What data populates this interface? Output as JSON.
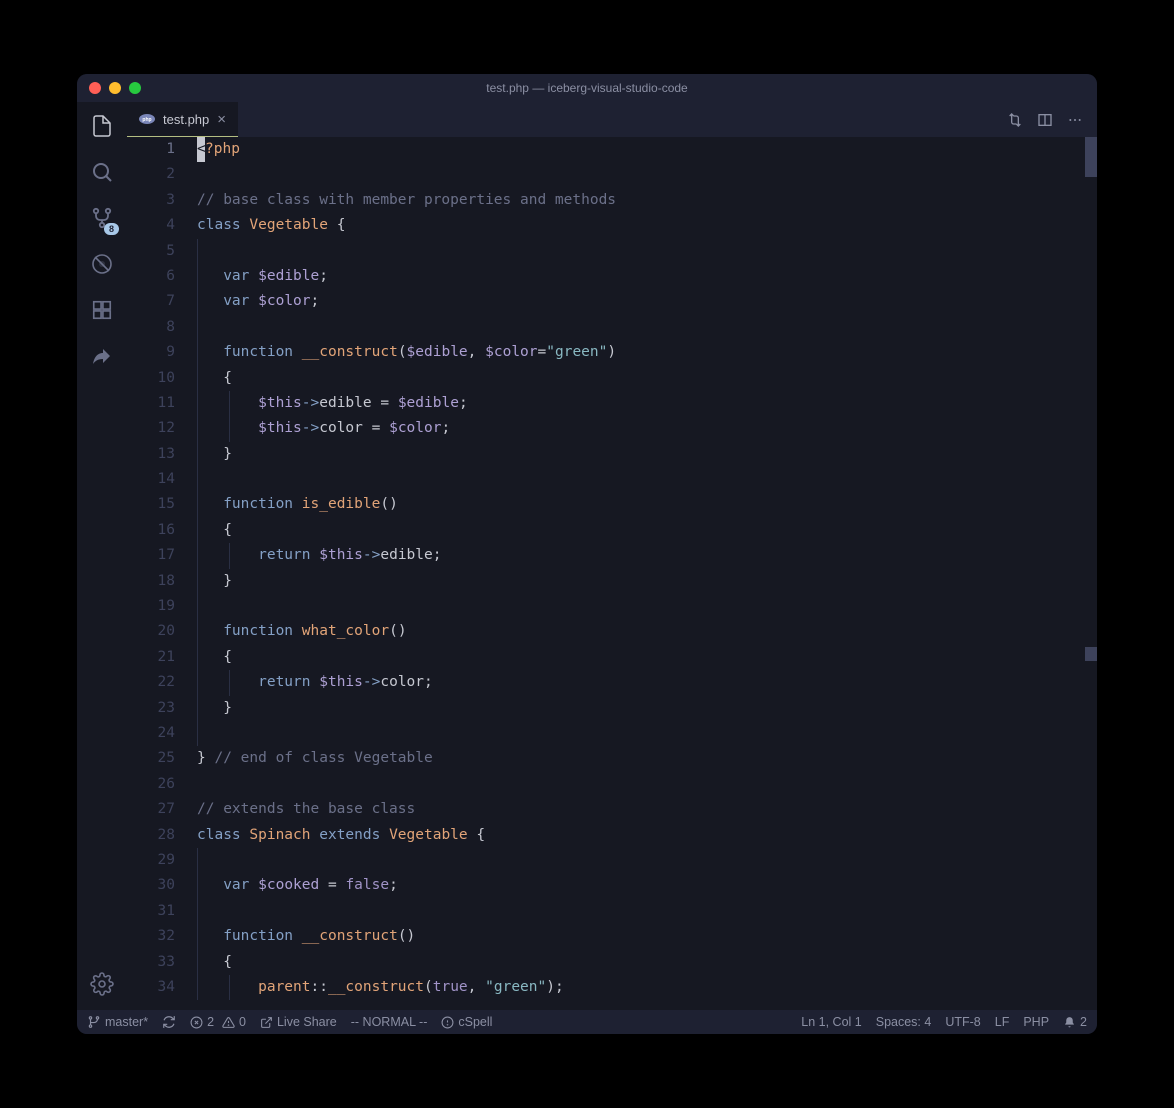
{
  "window": {
    "title": "test.php — iceberg-visual-studio-code"
  },
  "activity": {
    "scm_badge": "8"
  },
  "tab": {
    "label": "test.php"
  },
  "code": {
    "lines": [
      {
        "n": 1,
        "tokens": [
          {
            "t": "cursor",
            "v": "<"
          },
          {
            "t": "php",
            "v": "?php"
          }
        ],
        "current": true
      },
      {
        "n": 2,
        "tokens": []
      },
      {
        "n": 3,
        "tokens": [
          {
            "t": "comment",
            "v": "// base class with member properties and methods"
          }
        ]
      },
      {
        "n": 4,
        "tokens": [
          {
            "t": "keyword",
            "v": "class"
          },
          {
            "t": "sp",
            "v": " "
          },
          {
            "t": "type",
            "v": "Vegetable"
          },
          {
            "t": "sp",
            "v": " "
          },
          {
            "t": "punct",
            "v": "{"
          }
        ]
      },
      {
        "n": 5,
        "tokens": [],
        "indent": 1
      },
      {
        "n": 6,
        "tokens": [
          {
            "t": "sp",
            "v": "   "
          },
          {
            "t": "keyword",
            "v": "var"
          },
          {
            "t": "sp",
            "v": " "
          },
          {
            "t": "varname",
            "v": "$edible"
          },
          {
            "t": "punct",
            "v": ";"
          }
        ],
        "indent": 1
      },
      {
        "n": 7,
        "tokens": [
          {
            "t": "sp",
            "v": "   "
          },
          {
            "t": "keyword",
            "v": "var"
          },
          {
            "t": "sp",
            "v": " "
          },
          {
            "t": "varname",
            "v": "$color"
          },
          {
            "t": "punct",
            "v": ";"
          }
        ],
        "indent": 1
      },
      {
        "n": 8,
        "tokens": [],
        "indent": 1
      },
      {
        "n": 9,
        "tokens": [
          {
            "t": "sp",
            "v": "   "
          },
          {
            "t": "keyword",
            "v": "function"
          },
          {
            "t": "sp",
            "v": " "
          },
          {
            "t": "func",
            "v": "__construct"
          },
          {
            "t": "punct",
            "v": "("
          },
          {
            "t": "varname",
            "v": "$edible"
          },
          {
            "t": "punct",
            "v": ", "
          },
          {
            "t": "varname",
            "v": "$color"
          },
          {
            "t": "punct",
            "v": "="
          },
          {
            "t": "string",
            "v": "\"green\""
          },
          {
            "t": "punct",
            "v": ")"
          }
        ],
        "indent": 1
      },
      {
        "n": 10,
        "tokens": [
          {
            "t": "sp",
            "v": "   "
          },
          {
            "t": "punct",
            "v": "{"
          }
        ],
        "indent": 1
      },
      {
        "n": 11,
        "tokens": [
          {
            "t": "sp",
            "v": "       "
          },
          {
            "t": "this",
            "v": "$this"
          },
          {
            "t": "arrow",
            "v": "->"
          },
          {
            "t": "prop",
            "v": "edible"
          },
          {
            "t": "punct",
            "v": " = "
          },
          {
            "t": "varname",
            "v": "$edible"
          },
          {
            "t": "punct",
            "v": ";"
          }
        ],
        "indent": 2
      },
      {
        "n": 12,
        "tokens": [
          {
            "t": "sp",
            "v": "       "
          },
          {
            "t": "this",
            "v": "$this"
          },
          {
            "t": "arrow",
            "v": "->"
          },
          {
            "t": "prop",
            "v": "color"
          },
          {
            "t": "punct",
            "v": " = "
          },
          {
            "t": "varname",
            "v": "$color"
          },
          {
            "t": "punct",
            "v": ";"
          }
        ],
        "indent": 2
      },
      {
        "n": 13,
        "tokens": [
          {
            "t": "sp",
            "v": "   "
          },
          {
            "t": "punct",
            "v": "}"
          }
        ],
        "indent": 1
      },
      {
        "n": 14,
        "tokens": [],
        "indent": 1
      },
      {
        "n": 15,
        "tokens": [
          {
            "t": "sp",
            "v": "   "
          },
          {
            "t": "keyword",
            "v": "function"
          },
          {
            "t": "sp",
            "v": " "
          },
          {
            "t": "func",
            "v": "is_edible"
          },
          {
            "t": "punct",
            "v": "()"
          }
        ],
        "indent": 1
      },
      {
        "n": 16,
        "tokens": [
          {
            "t": "sp",
            "v": "   "
          },
          {
            "t": "punct",
            "v": "{"
          }
        ],
        "indent": 1
      },
      {
        "n": 17,
        "tokens": [
          {
            "t": "sp",
            "v": "       "
          },
          {
            "t": "keyword",
            "v": "return"
          },
          {
            "t": "sp",
            "v": " "
          },
          {
            "t": "this",
            "v": "$this"
          },
          {
            "t": "arrow",
            "v": "->"
          },
          {
            "t": "prop",
            "v": "edible"
          },
          {
            "t": "punct",
            "v": ";"
          }
        ],
        "indent": 2
      },
      {
        "n": 18,
        "tokens": [
          {
            "t": "sp",
            "v": "   "
          },
          {
            "t": "punct",
            "v": "}"
          }
        ],
        "indent": 1
      },
      {
        "n": 19,
        "tokens": [],
        "indent": 1
      },
      {
        "n": 20,
        "tokens": [
          {
            "t": "sp",
            "v": "   "
          },
          {
            "t": "keyword",
            "v": "function"
          },
          {
            "t": "sp",
            "v": " "
          },
          {
            "t": "func",
            "v": "what_color"
          },
          {
            "t": "punct",
            "v": "()"
          }
        ],
        "indent": 1
      },
      {
        "n": 21,
        "tokens": [
          {
            "t": "sp",
            "v": "   "
          },
          {
            "t": "punct",
            "v": "{"
          }
        ],
        "indent": 1
      },
      {
        "n": 22,
        "tokens": [
          {
            "t": "sp",
            "v": "       "
          },
          {
            "t": "keyword",
            "v": "return"
          },
          {
            "t": "sp",
            "v": " "
          },
          {
            "t": "this",
            "v": "$this"
          },
          {
            "t": "arrow",
            "v": "->"
          },
          {
            "t": "prop",
            "v": "color"
          },
          {
            "t": "punct",
            "v": ";"
          }
        ],
        "indent": 2
      },
      {
        "n": 23,
        "tokens": [
          {
            "t": "sp",
            "v": "   "
          },
          {
            "t": "punct",
            "v": "}"
          }
        ],
        "indent": 1
      },
      {
        "n": 24,
        "tokens": [],
        "indent": 1
      },
      {
        "n": 25,
        "tokens": [
          {
            "t": "punct",
            "v": "}"
          },
          {
            "t": "sp",
            "v": " "
          },
          {
            "t": "comment",
            "v": "// end of class Vegetable"
          }
        ]
      },
      {
        "n": 26,
        "tokens": []
      },
      {
        "n": 27,
        "tokens": [
          {
            "t": "comment",
            "v": "// extends the base class"
          }
        ]
      },
      {
        "n": 28,
        "tokens": [
          {
            "t": "keyword",
            "v": "class"
          },
          {
            "t": "sp",
            "v": " "
          },
          {
            "t": "type",
            "v": "Spinach"
          },
          {
            "t": "sp",
            "v": " "
          },
          {
            "t": "keyword",
            "v": "extends"
          },
          {
            "t": "sp",
            "v": " "
          },
          {
            "t": "type",
            "v": "Vegetable"
          },
          {
            "t": "sp",
            "v": " "
          },
          {
            "t": "punct",
            "v": "{"
          }
        ]
      },
      {
        "n": 29,
        "tokens": [],
        "indent": 1
      },
      {
        "n": 30,
        "tokens": [
          {
            "t": "sp",
            "v": "   "
          },
          {
            "t": "keyword",
            "v": "var"
          },
          {
            "t": "sp",
            "v": " "
          },
          {
            "t": "varname",
            "v": "$cooked"
          },
          {
            "t": "punct",
            "v": " = "
          },
          {
            "t": "bool",
            "v": "false"
          },
          {
            "t": "punct",
            "v": ";"
          }
        ],
        "indent": 1
      },
      {
        "n": 31,
        "tokens": [],
        "indent": 1
      },
      {
        "n": 32,
        "tokens": [
          {
            "t": "sp",
            "v": "   "
          },
          {
            "t": "keyword",
            "v": "function"
          },
          {
            "t": "sp",
            "v": " "
          },
          {
            "t": "func",
            "v": "__construct"
          },
          {
            "t": "punct",
            "v": "()"
          }
        ],
        "indent": 1
      },
      {
        "n": 33,
        "tokens": [
          {
            "t": "sp",
            "v": "   "
          },
          {
            "t": "punct",
            "v": "{"
          }
        ],
        "indent": 1
      },
      {
        "n": 34,
        "tokens": [
          {
            "t": "sp",
            "v": "       "
          },
          {
            "t": "type",
            "v": "parent"
          },
          {
            "t": "punct",
            "v": "::"
          },
          {
            "t": "func",
            "v": "__construct"
          },
          {
            "t": "punct",
            "v": "("
          },
          {
            "t": "bool",
            "v": "true"
          },
          {
            "t": "punct",
            "v": ", "
          },
          {
            "t": "string",
            "v": "\"green\""
          },
          {
            "t": "punct",
            "v": ");"
          }
        ],
        "indent": 2
      }
    ]
  },
  "status": {
    "branch": "master*",
    "errors": "2",
    "warnings": "0",
    "liveshare": "Live Share",
    "vim_mode": "-- NORMAL --",
    "cspell": "cSpell",
    "position": "Ln 1, Col 1",
    "spaces": "Spaces: 4",
    "encoding": "UTF-8",
    "eol": "LF",
    "language": "PHP",
    "notifications": "2"
  }
}
